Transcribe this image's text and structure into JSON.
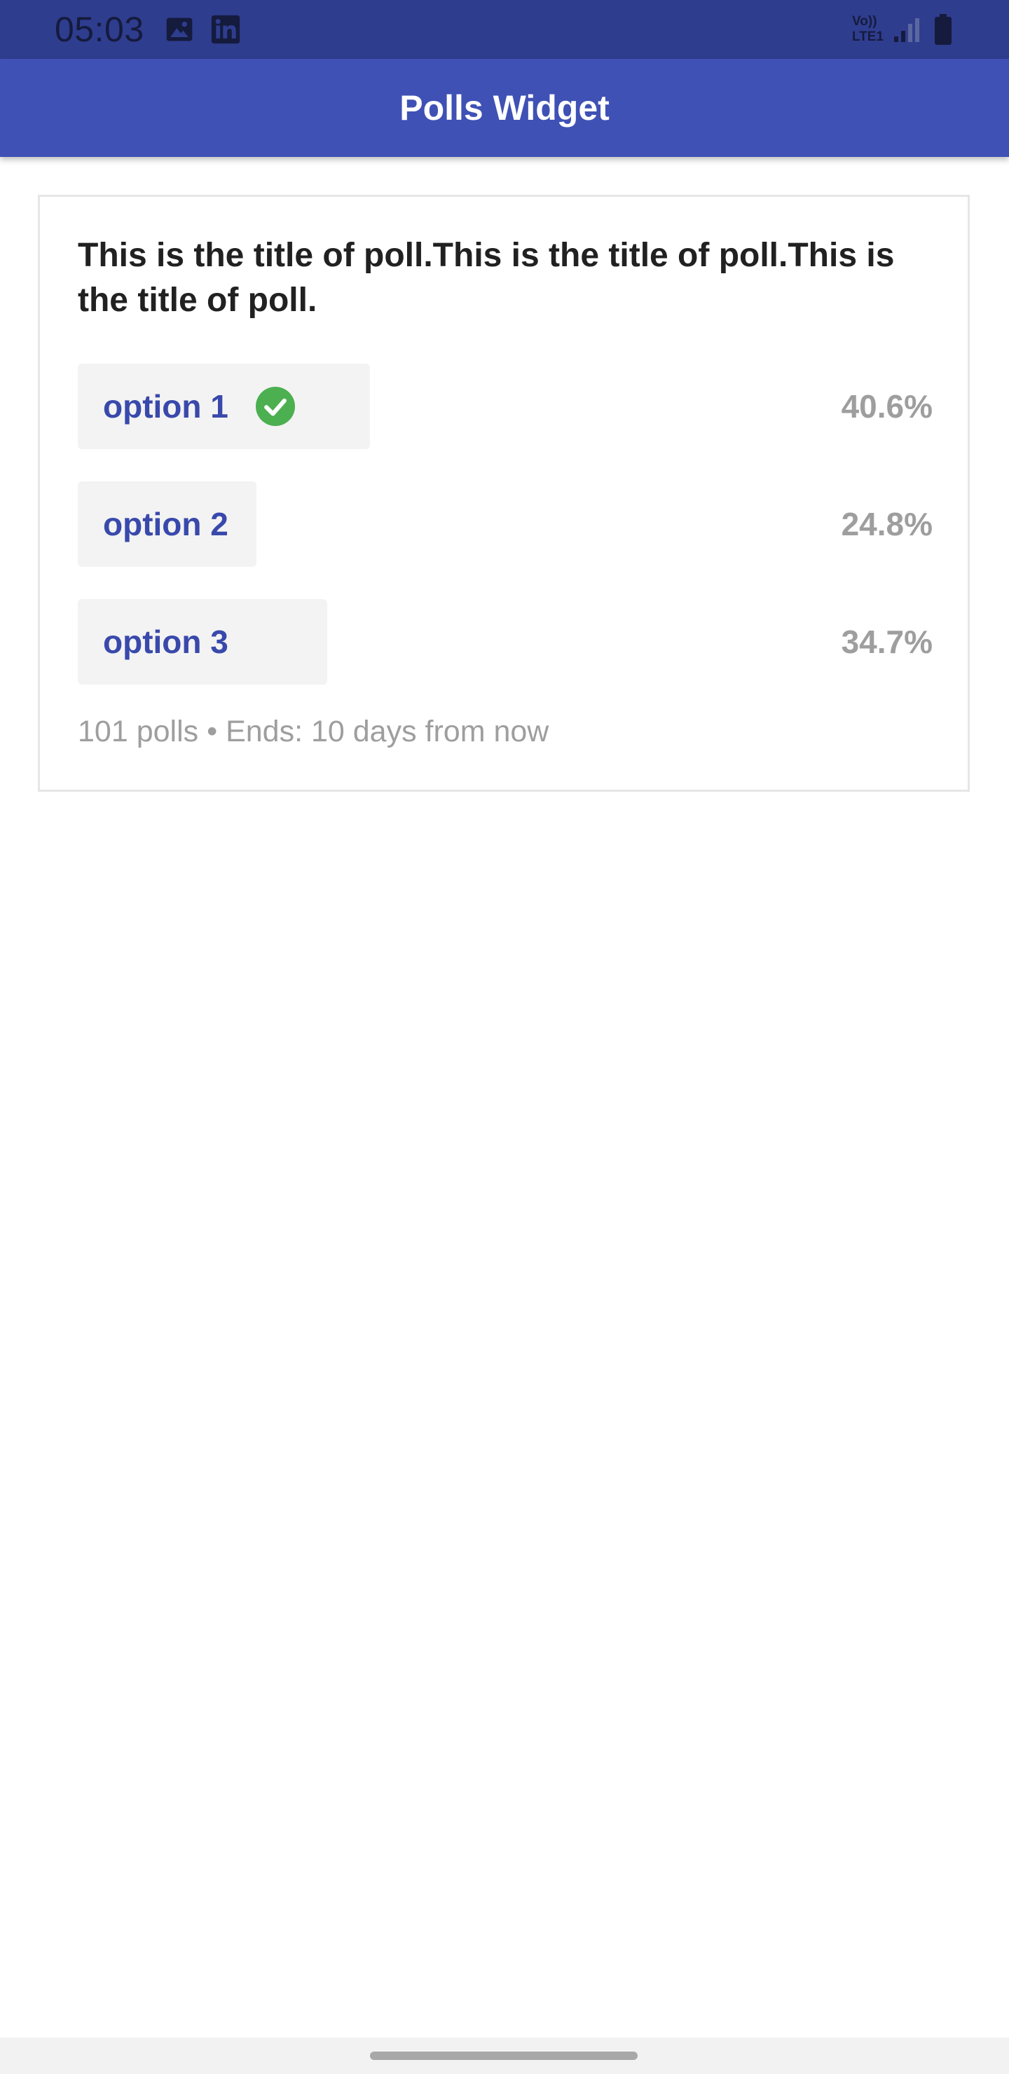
{
  "status_bar": {
    "time": "05:03",
    "icons": [
      "image-icon",
      "linkedin-icon",
      "volte-icon",
      "signal-icon",
      "battery-icon"
    ],
    "volte_label_top": "Vo))",
    "volte_label_bottom": "LTE1",
    "background_color": "#2f3d8f"
  },
  "app_bar": {
    "title": "Polls Widget",
    "background_color": "#3f51b5"
  },
  "poll": {
    "title": "This is the title of poll.This is the title of poll.This is the title of poll.",
    "options": [
      {
        "label": "option 1",
        "percent": "40.6%",
        "share": 0.406,
        "selected": true
      },
      {
        "label": "option 2",
        "percent": "24.8%",
        "share": 0.248,
        "selected": false
      },
      {
        "label": "option 3",
        "percent": "34.7%",
        "share": 0.347,
        "selected": false
      }
    ],
    "footer": "101 polls • Ends: 10 days from now",
    "accent_color": "#3949ab",
    "check_color": "#4caf50"
  }
}
